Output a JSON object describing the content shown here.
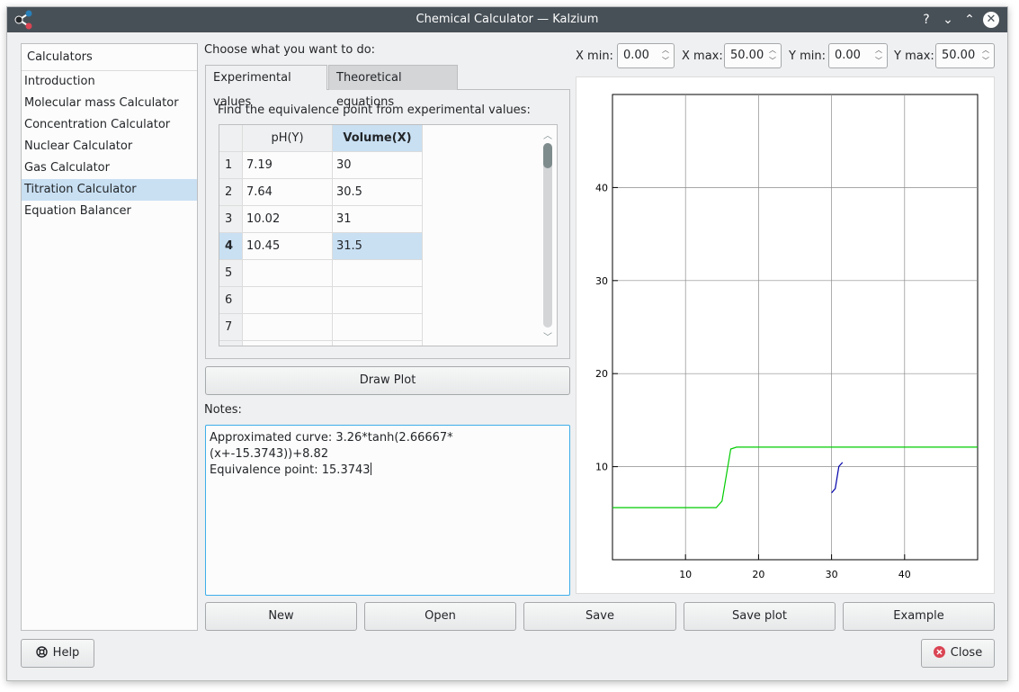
{
  "window": {
    "title": "Chemical Calculator — Kalzium"
  },
  "titlebar": {
    "help": "?",
    "minimize": "⌄",
    "maximize": "⌃",
    "close": "✕"
  },
  "sidebar": {
    "header": "Calculators",
    "items": [
      {
        "label": "Introduction"
      },
      {
        "label": "Molecular mass Calculator"
      },
      {
        "label": "Concentration Calculator"
      },
      {
        "label": "Nuclear Calculator"
      },
      {
        "label": "Gas Calculator"
      },
      {
        "label": "Titration Calculator"
      },
      {
        "label": "Equation Balancer"
      }
    ],
    "selected": "Titration Calculator"
  },
  "main": {
    "prompt": "Choose what you want to do:",
    "tabs": [
      {
        "label": "Experimental values"
      },
      {
        "label": "Theoretical equations"
      }
    ],
    "find_label": "Find the equivalence point from experimental values:",
    "table": {
      "columns": [
        "pH(Y)",
        "Volume(X)"
      ],
      "row_numbers": [
        "1",
        "2",
        "3",
        "4",
        "5",
        "6",
        "7"
      ],
      "rows": [
        [
          "7.19",
          "30"
        ],
        [
          "7.64",
          "30.5"
        ],
        [
          "10.02",
          "31"
        ],
        [
          "10.45",
          "31.5"
        ],
        [
          "",
          ""
        ],
        [
          "",
          ""
        ],
        [
          "",
          ""
        ]
      ]
    },
    "draw_plot": "Draw Plot",
    "notes_label": "Notes:",
    "notes_line1": "Approximated curve: 3.26*tanh(2.66667*(x+-15.3743))+8.82",
    "notes_line2": "Equivalence point: 15.3743"
  },
  "range": {
    "xmin_label": "X min:",
    "xmin": "0.00",
    "xmax_label": "X max:",
    "xmax": "50.00",
    "ymin_label": "Y min:",
    "ymin": "0.00",
    "ymax_label": "Y max:",
    "ymax": "50.00"
  },
  "actions": {
    "new": "New",
    "open": "Open",
    "save": "Save",
    "save_plot": "Save plot",
    "example": "Example"
  },
  "footer": {
    "help": "Help",
    "close": "Close"
  },
  "colors": {
    "selection": "#c9e0f3",
    "focus": "#3daee9",
    "curve": "#00cc00",
    "points": "#0000aa",
    "close_icon": "#da4453"
  },
  "chart_data": {
    "type": "line",
    "xlim": [
      0,
      50
    ],
    "ylim": [
      0,
      50
    ],
    "grid": true,
    "x_ticks": [
      "10",
      "20",
      "30",
      "40"
    ],
    "y_ticks": [
      "10",
      "20",
      "30",
      "40"
    ],
    "series": [
      {
        "x": [
          0,
          14.2,
          15.0,
          16.2,
          17.0,
          20,
          30,
          40,
          50
        ],
        "y": [
          5.6,
          5.6,
          6.3,
          11.9,
          12.1,
          12.1,
          12.1,
          12.1,
          12.1
        ],
        "color": "#00cc00"
      },
      {
        "x": [
          30,
          30.5,
          31,
          31.5
        ],
        "y": [
          7.19,
          7.64,
          10.02,
          10.45
        ],
        "color": "#0000aa"
      }
    ]
  }
}
